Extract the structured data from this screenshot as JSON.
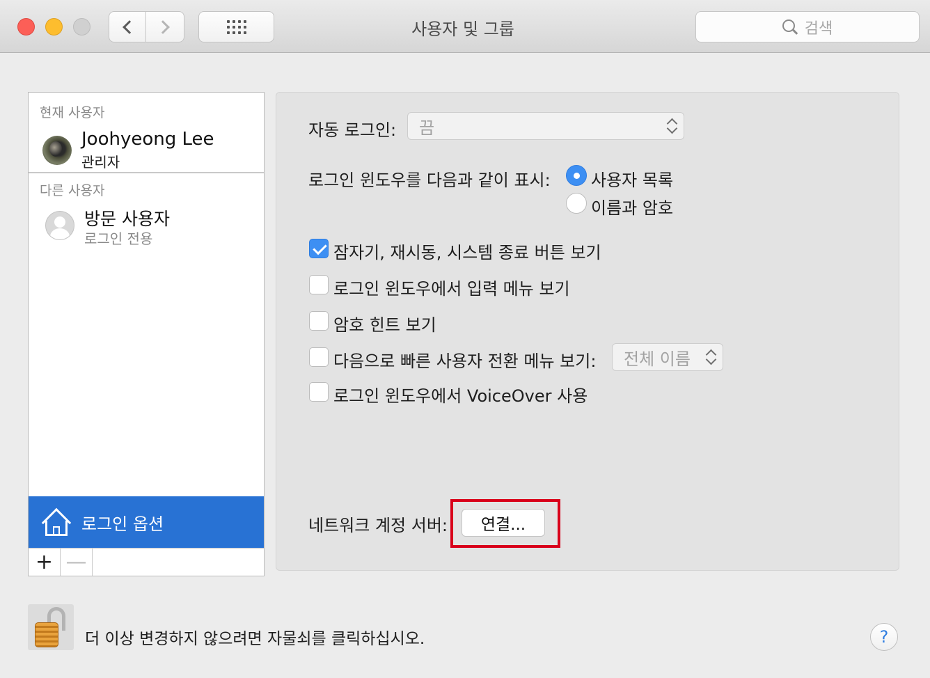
{
  "window": {
    "title": "사용자 및 그룹",
    "search_placeholder": "검색"
  },
  "sidebar": {
    "current_label": "현재 사용자",
    "current_user": {
      "name": "Joohyeong Lee",
      "role": "관리자"
    },
    "other_label": "다른 사용자",
    "guest_user": {
      "name": "방문 사용자",
      "role": "로그인 전용"
    },
    "login_options": "로그인 옵션",
    "add_label": "+",
    "remove_label": "—"
  },
  "options": {
    "auto_login_label": "자동 로그인:",
    "auto_login_value": "끔",
    "display_label": "로그인 윈도우를 다음과 같이 표시:",
    "display_options": [
      {
        "label": "사용자 목록",
        "selected": true
      },
      {
        "label": "이름과 암호",
        "selected": false
      }
    ],
    "checkboxes": [
      {
        "label": "잠자기, 재시동, 시스템 종료 버튼 보기",
        "checked": true
      },
      {
        "label": "로그인 윈도우에서 입력 메뉴 보기",
        "checked": false
      },
      {
        "label": "암호 힌트 보기",
        "checked": false
      },
      {
        "label": "다음으로 빠른 사용자 전환 메뉴 보기:",
        "checked": false
      },
      {
        "label": "로그인 윈도우에서 VoiceOver 사용",
        "checked": false
      }
    ],
    "fast_switch_value": "전체 이름",
    "network_label": "네트워크 계정 서버:",
    "connect_button": "연결..."
  },
  "footer": {
    "lock_text": "더 이상 변경하지 않으려면 자물쇠를 클릭하십시오.",
    "help_label": "?"
  },
  "colors": {
    "accent": "#3d8ff3",
    "selection": "#2872d4",
    "highlight_box": "#d9001b"
  },
  "icons": [
    "chevron-left-icon",
    "chevron-right-icon",
    "grid-icon",
    "search-icon",
    "house-icon",
    "lock-icon",
    "help-icon"
  ]
}
